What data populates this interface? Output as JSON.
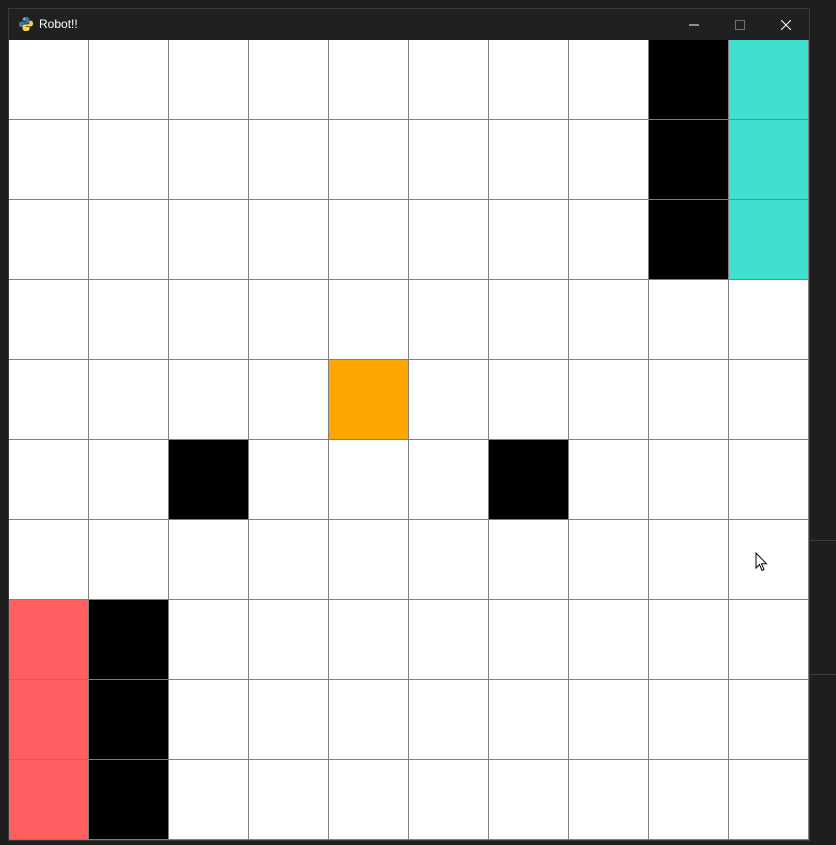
{
  "window": {
    "title": "Robot!!",
    "app_icon": "python-icon"
  },
  "controls": {
    "minimize_icon": "minimize-icon",
    "maximize_icon": "maximize-icon",
    "close_icon": "close-icon"
  },
  "grid": {
    "rows": 10,
    "cols": 10,
    "colors": {
      "empty": "#ffffff",
      "wall": "#000000",
      "goal": "#40e0d0",
      "robot": "#ffa500",
      "start": "#ff5f5f",
      "line": "#808080"
    },
    "cells": [
      [
        "empty",
        "empty",
        "empty",
        "empty",
        "empty",
        "empty",
        "empty",
        "empty",
        "wall",
        "goal"
      ],
      [
        "empty",
        "empty",
        "empty",
        "empty",
        "empty",
        "empty",
        "empty",
        "empty",
        "wall",
        "goal"
      ],
      [
        "empty",
        "empty",
        "empty",
        "empty",
        "empty",
        "empty",
        "empty",
        "empty",
        "wall",
        "goal"
      ],
      [
        "empty",
        "empty",
        "empty",
        "empty",
        "empty",
        "empty",
        "empty",
        "empty",
        "empty",
        "empty"
      ],
      [
        "empty",
        "empty",
        "empty",
        "empty",
        "robot",
        "empty",
        "empty",
        "empty",
        "empty",
        "empty"
      ],
      [
        "empty",
        "empty",
        "wall",
        "empty",
        "empty",
        "empty",
        "wall",
        "empty",
        "empty",
        "empty"
      ],
      [
        "empty",
        "empty",
        "empty",
        "empty",
        "empty",
        "empty",
        "empty",
        "empty",
        "empty",
        "empty"
      ],
      [
        "start",
        "wall",
        "empty",
        "empty",
        "empty",
        "empty",
        "empty",
        "empty",
        "empty",
        "empty"
      ],
      [
        "start",
        "wall",
        "empty",
        "empty",
        "empty",
        "empty",
        "empty",
        "empty",
        "empty",
        "empty"
      ],
      [
        "start",
        "wall",
        "empty",
        "empty",
        "empty",
        "empty",
        "empty",
        "empty",
        "empty",
        "empty"
      ]
    ]
  }
}
